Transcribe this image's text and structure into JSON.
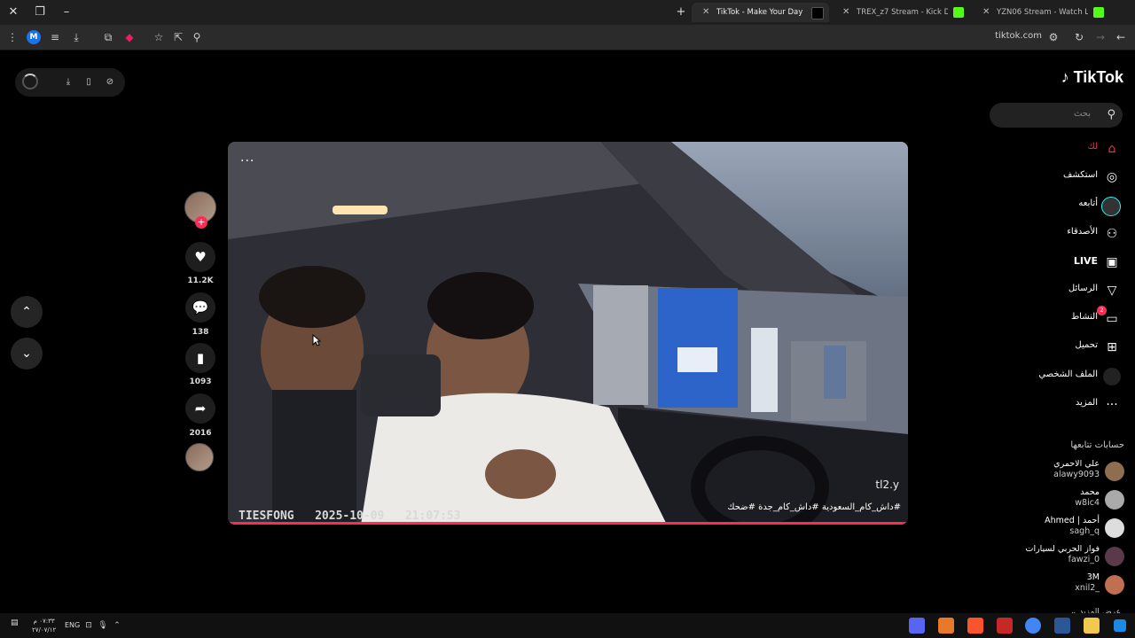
{
  "browser": {
    "tabs": [
      {
        "label": "TikTok - Make Your Day",
        "active": true
      },
      {
        "label": "TREX_z7 Stream - Kick Dash",
        "active": false
      },
      {
        "label": "YZN06 Stream - Watch Live on",
        "active": false
      }
    ],
    "new_tab": "+",
    "url": "tiktok.com"
  },
  "player": {
    "watermark": "TIESFONG   2025-10-09   21:07:53",
    "handle": "tl2.y",
    "hashtags": "#داش_كام_السعودية #داش_كام_جدة #ضحك",
    "progress": 0.999,
    "more": "···"
  },
  "actions": {
    "likes": "11.2K",
    "comments": "138",
    "saves": "1093",
    "shares": "2016"
  },
  "sidebar": {
    "logo": "TikTok",
    "search_placeholder": "بحث",
    "nav": [
      {
        "label": "لك",
        "icon": "home-icon",
        "active": true
      },
      {
        "label": "استكشف",
        "icon": "compass-icon"
      },
      {
        "label": "أتابعه",
        "icon": "following-icon"
      },
      {
        "label": "الأصدقاء",
        "icon": "friends-icon"
      },
      {
        "label": "LIVE",
        "icon": "live-icon"
      },
      {
        "label": "الرسائل",
        "icon": "messages-icon"
      },
      {
        "label": "النشاط",
        "icon": "activity-icon",
        "badge": "2"
      },
      {
        "label": "تحميل",
        "icon": "upload-icon"
      },
      {
        "label": "الملف الشخصي",
        "icon": "profile-icon"
      },
      {
        "label": "المزيد",
        "icon": "more-icon"
      }
    ],
    "following_title": "حسابات تتابعها",
    "following": [
      {
        "name": "علي الاحمري",
        "handle": "alawy9093"
      },
      {
        "name": "محمد",
        "handle": "w8ic4"
      },
      {
        "name": "Ahmed | أحمد",
        "handle": "sagh_q"
      },
      {
        "name": "فواز الحربي لسيارات",
        "handle": "fawzi_0"
      },
      {
        "name": "3M",
        "handle": "xnil2_"
      }
    ],
    "show_more": "عرض المزيد"
  },
  "taskbar": {
    "time": "٠٧:٣٣ م",
    "date": "٢٧/٠٧/١٢",
    "lang": "ENG"
  }
}
